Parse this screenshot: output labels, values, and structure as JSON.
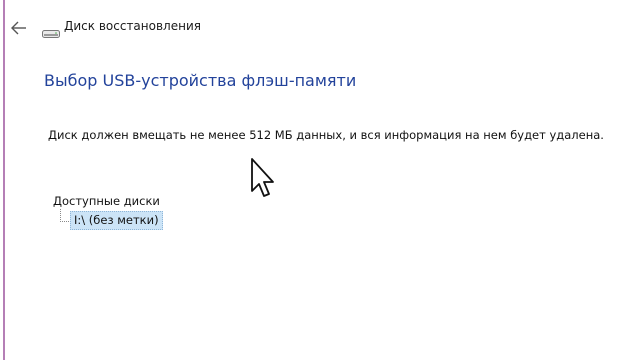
{
  "window": {
    "title": "Диск восстановления"
  },
  "page": {
    "title": "Выбор USB-устройства флэш-памяти",
    "description": "Диск должен вмещать не менее 512 МБ данных, и вся информация на нем будет удалена."
  },
  "drives": {
    "label": "Доступные диски",
    "items": [
      {
        "label": "I:\\ (без метки)",
        "selected": true
      }
    ]
  },
  "icons": {
    "back": "back-arrow-icon",
    "drive": "drive-icon",
    "cursor": "mouse-pointer-icon"
  },
  "colors": {
    "accent_border": "#b57fb6",
    "title_blue": "#23439b",
    "selection_bg": "#cce4f7"
  }
}
